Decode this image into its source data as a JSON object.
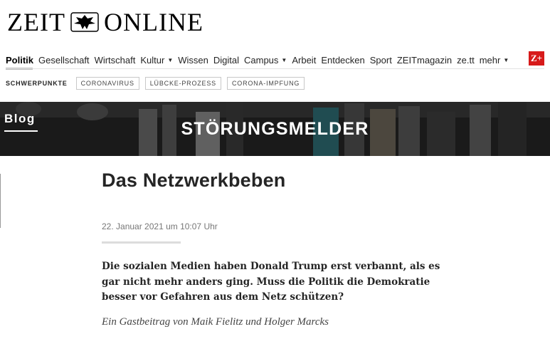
{
  "logo": {
    "left": "ZEIT",
    "right": "ONLINE"
  },
  "nav": {
    "items": [
      {
        "label": "Politik",
        "active": true,
        "caret": false
      },
      {
        "label": "Gesellschaft",
        "active": false,
        "caret": false
      },
      {
        "label": "Wirtschaft",
        "active": false,
        "caret": false
      },
      {
        "label": "Kultur",
        "active": false,
        "caret": true
      },
      {
        "label": "Wissen",
        "active": false,
        "caret": false
      },
      {
        "label": "Digital",
        "active": false,
        "caret": false
      },
      {
        "label": "Campus",
        "active": false,
        "caret": true
      },
      {
        "label": "Arbeit",
        "active": false,
        "caret": false
      },
      {
        "label": "Entdecken",
        "active": false,
        "caret": false
      },
      {
        "label": "Sport",
        "active": false,
        "caret": false
      },
      {
        "label": "ZEITmagazin",
        "active": false,
        "caret": false
      },
      {
        "label": "ze.tt",
        "active": false,
        "caret": false
      },
      {
        "label": "mehr",
        "active": false,
        "caret": true
      }
    ],
    "caret_glyph": "▼",
    "zplus": "Z+"
  },
  "topics": {
    "label": "SCHWERPUNKTE",
    "items": [
      "CORONAVIRUS",
      "LÜBCKE-PROZESS",
      "CORONA-IMPFUNG"
    ]
  },
  "banner": {
    "blog_label": "Blog",
    "title": "STÖRUNGSMELDER"
  },
  "article": {
    "headline": "Das Netzwerkbeben",
    "date": "22. Januar 2021 um 10:07 Uhr",
    "lead": "Die sozialen Medien haben Donald Trump erst verbannt, als es gar nicht mehr anders ging. Muss die Politik die Demokratie besser vor Gefahren aus dem Netz schützen?",
    "byline": "Ein Gastbeitrag von Maik Fielitz und Holger Marcks"
  },
  "colors": {
    "accent": "#d71a1a",
    "banner_bg": "#1f1f1f"
  }
}
